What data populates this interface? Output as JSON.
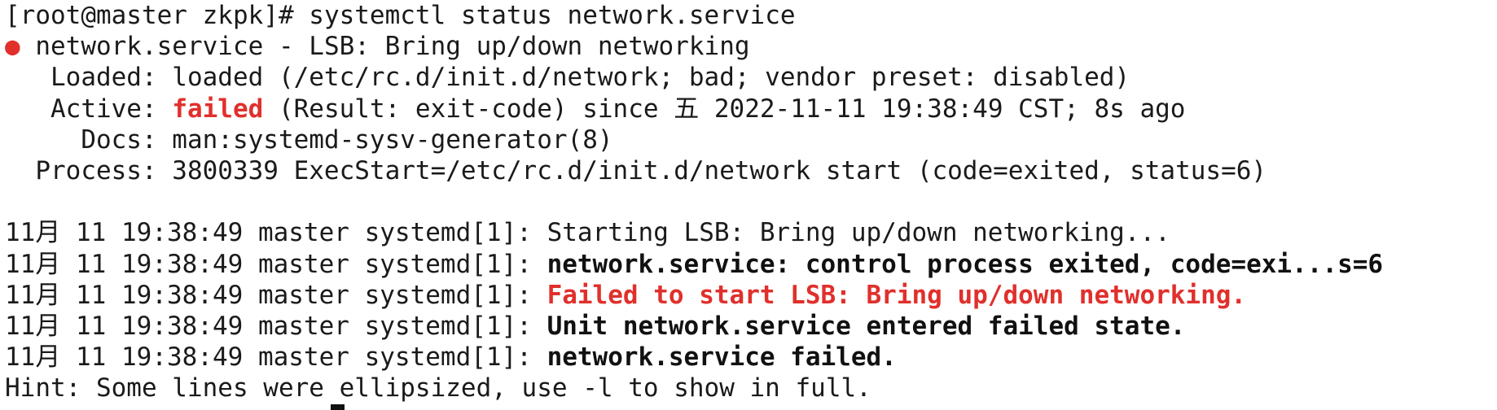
{
  "colors": {
    "background": "#ffffff",
    "text": "#1a1a1a",
    "error_red": "#e0302c"
  },
  "terminal": {
    "prompt": "[root@master zkpk]# ",
    "command": "systemctl status network.service",
    "status_dot": "●",
    "unit_line": " network.service - LSB: Bring up/down networking",
    "loaded": "   Loaded: loaded (/etc/rc.d/init.d/network; bad; vendor preset: disabled)",
    "active_label": "   Active: ",
    "active_state": "failed",
    "active_rest": " (Result: exit-code) since 五 2022-11-11 19:38:49 CST; 8s ago",
    "docs": "     Docs: man:systemd-sysv-generator(8)",
    "process": "  Process: 3800339 ExecStart=/etc/rc.d/init.d/network start (code=exited, status=6)",
    "journal": [
      {
        "prefix": "11月 11 19:38:49 master systemd[1]: ",
        "message": "Starting LSB: Bring up/down networking...",
        "style": "normal"
      },
      {
        "prefix": "11月 11 19:38:49 master systemd[1]: ",
        "message": "network.service: control process exited, code=exi...s=6",
        "style": "bold"
      },
      {
        "prefix": "11月 11 19:38:49 master systemd[1]: ",
        "message": "Failed to start LSB: Bring up/down networking.",
        "style": "red"
      },
      {
        "prefix": "11月 11 19:38:49 master systemd[1]: ",
        "message": "Unit network.service entered failed state.",
        "style": "bold"
      },
      {
        "prefix": "11月 11 19:38:49 master systemd[1]: ",
        "message": "network.service failed.",
        "style": "bold"
      }
    ],
    "hint": "Hint: Some lines were ellipsized, use -l to show in full.",
    "cursor_icon": "block-cursor"
  }
}
